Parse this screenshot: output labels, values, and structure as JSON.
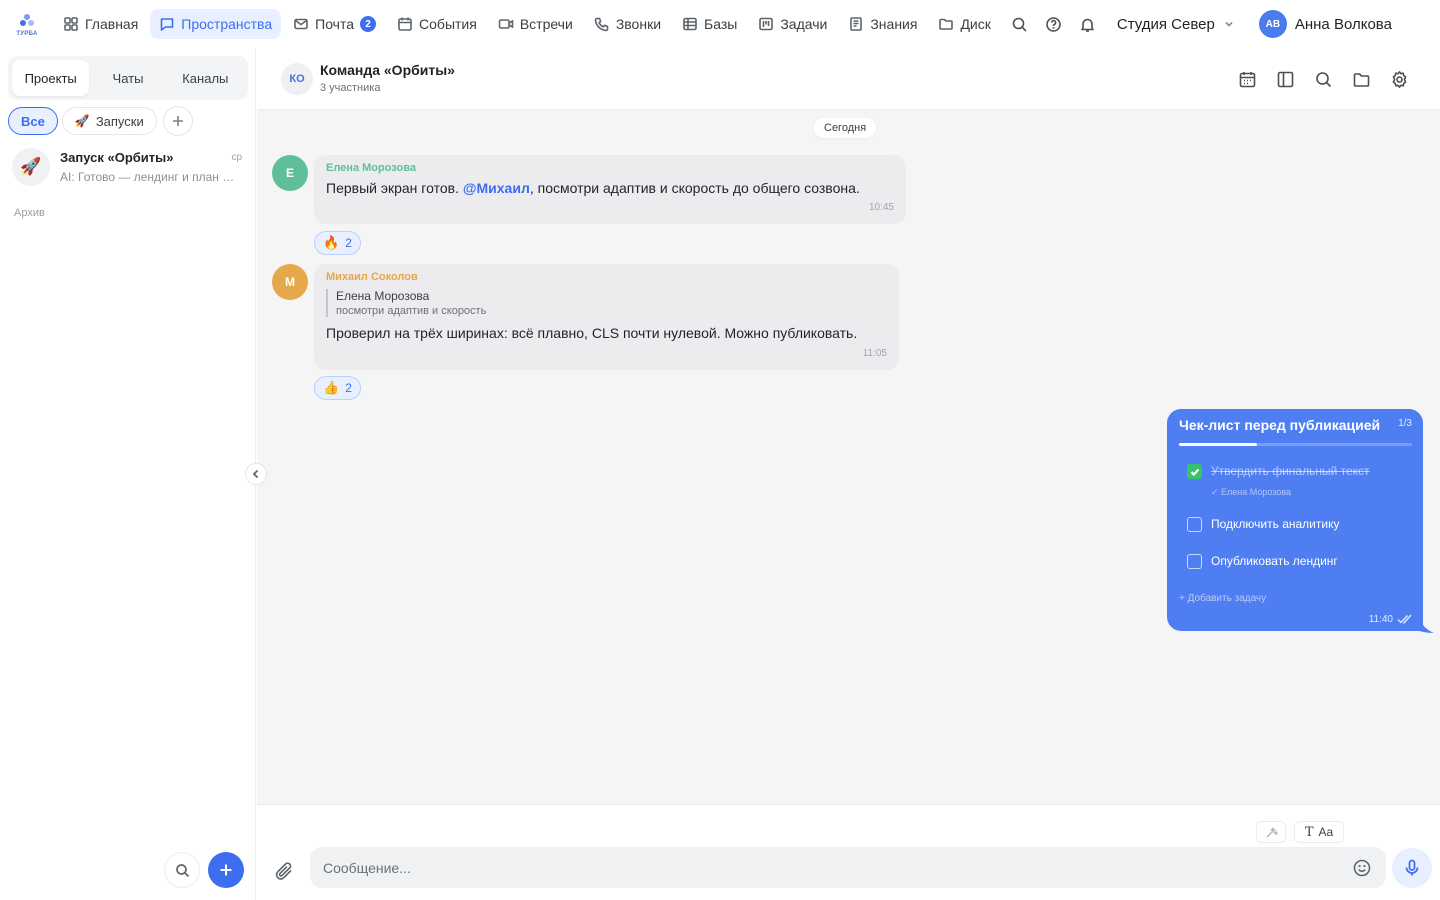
{
  "app": {
    "logo_text": "ТУРБА",
    "workspace": "Студия Север",
    "user": {
      "initials": "АВ",
      "name": "Анна Волкова"
    }
  },
  "nav": {
    "items": [
      {
        "label": "Главная",
        "icon": "grid-icon"
      },
      {
        "label": "Пространства",
        "icon": "chat-bubble-icon",
        "active": true
      },
      {
        "label": "Почта",
        "icon": "mail-icon",
        "badge": "2"
      },
      {
        "label": "События",
        "icon": "calendar-icon"
      },
      {
        "label": "Встречи",
        "icon": "video-icon"
      },
      {
        "label": "Звонки",
        "icon": "phone-icon"
      },
      {
        "label": "Базы",
        "icon": "table-icon"
      },
      {
        "label": "Задачи",
        "icon": "kanban-icon"
      },
      {
        "label": "Знания",
        "icon": "book-icon"
      },
      {
        "label": "Диск",
        "icon": "folder-icon"
      }
    ]
  },
  "sidebar": {
    "tabs": [
      "Проекты",
      "Чаты",
      "Каналы"
    ],
    "filters": [
      {
        "label": "Все",
        "active": true
      },
      {
        "label": "Запуски",
        "emoji": "🚀"
      }
    ],
    "chats": [
      {
        "emoji": "🚀",
        "title": "Запуск «Орбиты»",
        "time": "ср",
        "preview": "AI: Готово — лендинг и план публикации"
      }
    ],
    "archive_label": "Архив"
  },
  "room": {
    "initials": "КО",
    "title": "Команда «Орбиты»",
    "subtitle": "3 участника",
    "date_separator": "Сегодня"
  },
  "messages": [
    {
      "initial": "Е",
      "author": "Елена Морозова",
      "author_color": "#5fbf9a",
      "text_before": "Первый экран готов. ",
      "mention": "@Михаил",
      "text_after": ", посмотри адаптив и скорость до общего созвона.",
      "time": "10:45",
      "reaction": {
        "emoji": "🔥",
        "count": "2"
      }
    },
    {
      "initial": "М",
      "author": "Михаил Соколов",
      "author_color": "#e5a84a",
      "quote": {
        "author": "Елена Морозова",
        "text": "посмотри адаптив и скорость"
      },
      "text": "Проверил на трёх ширинах: всё плавно, CLS почти нулевой. Можно публиковать.",
      "time": "11:05",
      "reaction": {
        "emoji": "👍",
        "count": "2"
      }
    }
  ],
  "checklist": {
    "title": "Чек-лист перед публикацией",
    "count": "1/3",
    "progress": 0.333,
    "items": [
      {
        "label": "Утвердить финальный текст",
        "done": true,
        "done_by": "✓ Елена Морозова"
      },
      {
        "label": "Подключить аналитику",
        "done": false
      },
      {
        "label": "Опубликовать лендинг",
        "done": false
      }
    ],
    "add_label": "+ Добавить задачу",
    "time": "11:40"
  },
  "composer": {
    "placeholder": "Сообщение...",
    "format_label": "Aa"
  },
  "colors": {
    "accent": "#3d6ef0",
    "checklist_bg": "#4f7ef2",
    "done_green": "#35c46a"
  }
}
